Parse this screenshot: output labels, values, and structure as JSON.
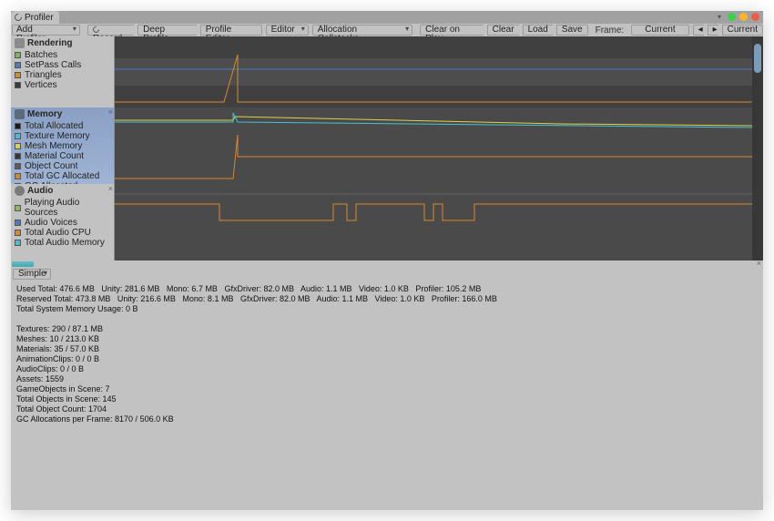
{
  "tab_title": "Profiler",
  "toolbar": {
    "add_profiler": "Add Profiler",
    "record": "Record",
    "deep_profile": "Deep Profile",
    "profile_editor": "Profile Editor",
    "editor": "Editor",
    "allocation_callstacks": "Allocation Callstacks",
    "clear_on_play": "Clear on Play",
    "clear": "Clear",
    "load": "Load",
    "save": "Save",
    "frame_label": "Frame:",
    "frame_value": "Current",
    "current": "Current"
  },
  "modules": {
    "rendering": {
      "title": "Rendering",
      "legend": [
        {
          "label": "Batches",
          "color": "#6fbf4a"
        },
        {
          "label": "SetPass Calls",
          "color": "#4a7bbf"
        },
        {
          "label": "Triangles",
          "color": "#d68a2a"
        },
        {
          "label": "Vertices",
          "color": "#3a3a3a"
        }
      ]
    },
    "memory": {
      "title": "Memory",
      "legend": [
        {
          "label": "Total Allocated",
          "color": "#1a1a1a"
        },
        {
          "label": "Texture Memory",
          "color": "#46c0d4"
        },
        {
          "label": "Mesh Memory",
          "color": "#e0cf4a"
        },
        {
          "label": "Material Count",
          "color": "#35353a"
        },
        {
          "label": "Object Count",
          "color": "#5a5a5a"
        },
        {
          "label": "Total GC Allocated",
          "color": "#d48a2a"
        },
        {
          "label": "GC Allocated",
          "color": "#6a4a2a"
        }
      ]
    },
    "audio": {
      "title": "Audio",
      "legend": [
        {
          "label": "Playing Audio Sources",
          "color": "#8bbf4a"
        },
        {
          "label": "Audio Voices",
          "color": "#4a7bbf"
        },
        {
          "label": "Total Audio CPU",
          "color": "#d68a2a"
        },
        {
          "label": "Total Audio Memory",
          "color": "#46c0d4"
        }
      ]
    }
  },
  "detail_mode": "Simple",
  "details": {
    "line1": "Used Total: 476.6 MB   Unity: 281.6 MB   Mono: 6.7 MB   GfxDriver: 82.0 MB   Audio: 1.1 MB   Video: 1.0 KB   Profiler: 105.2 MB",
    "line2": "Reserved Total: 473.8 MB   Unity: 216.6 MB   Mono: 8.1 MB   GfxDriver: 82.0 MB   Audio: 1.1 MB   Video: 1.0 KB   Profiler: 166.0 MB",
    "line3": "Total System Memory Usage: 0 B",
    "textures": "Textures: 290 / 87.1 MB",
    "meshes": "Meshes: 10 / 213.0 KB",
    "materials": "Materials: 35 / 57.0 KB",
    "anim": "AnimationClips: 0 / 0 B",
    "audio": "AudioClips: 0 / 0 B",
    "assets": "Assets: 1559",
    "go": "GameObjects in Scene: 7",
    "to": "Total Objects in Scene: 145",
    "toc": "Total Object Count: 1704",
    "gc": "GC Allocations per Frame: 8170 / 506.0 KB"
  },
  "colors": {
    "orange": "#d68a2a",
    "yellow": "#e0cf4a",
    "cyan": "#46c0d4",
    "green": "#8bbf4a"
  }
}
